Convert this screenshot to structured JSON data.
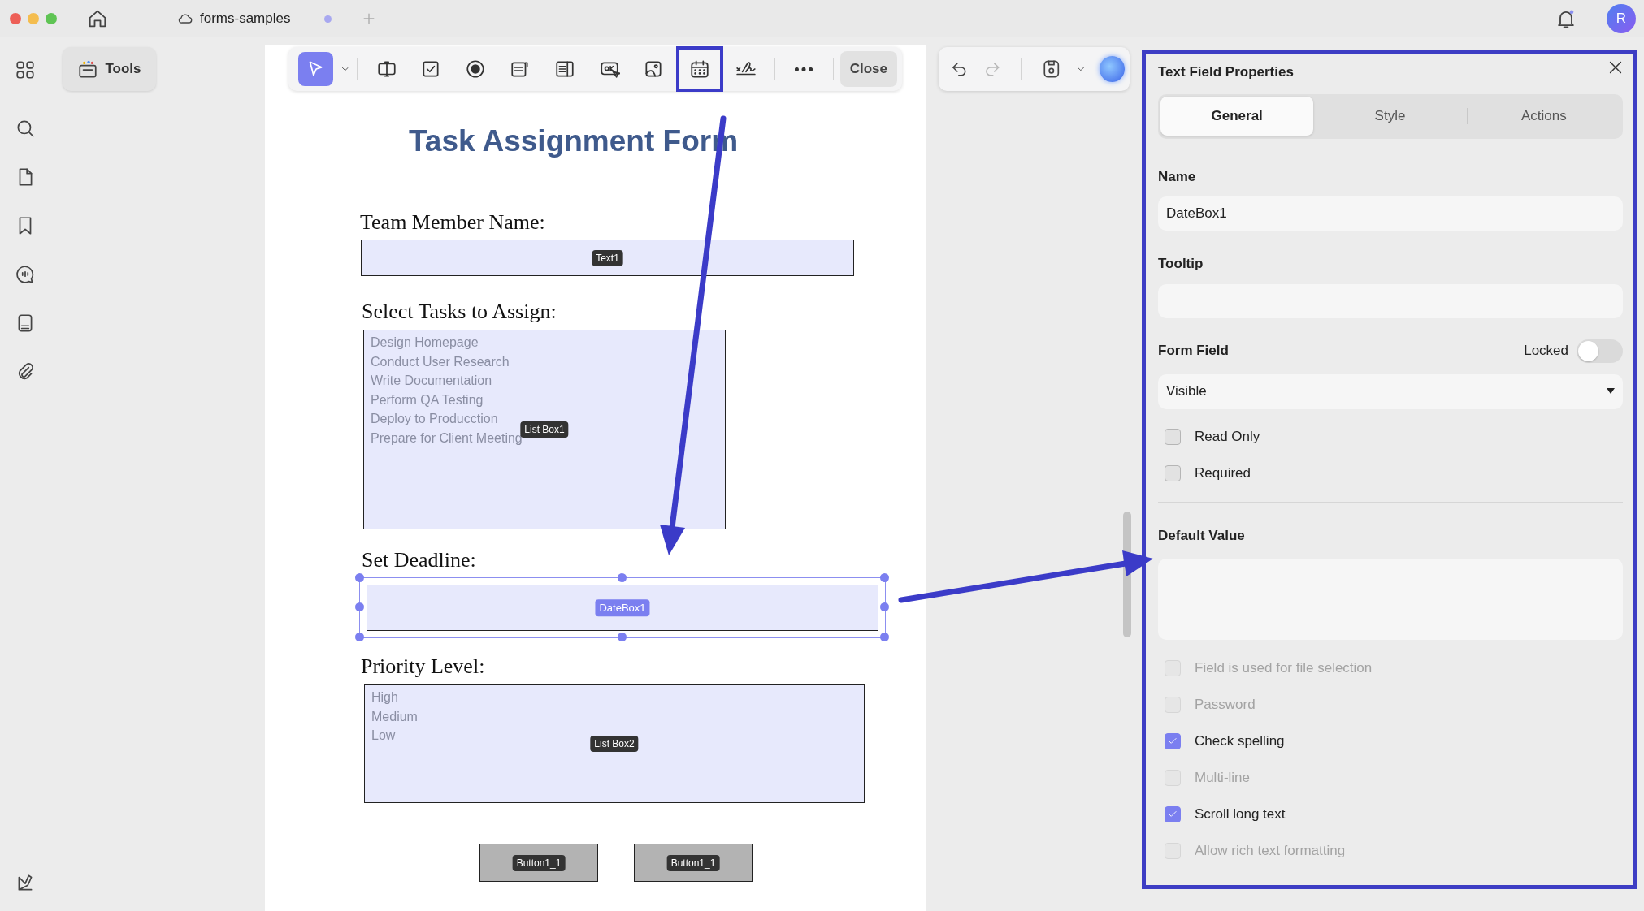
{
  "window": {
    "tab_title": "forms-samples",
    "avatar": "R"
  },
  "sidebar": {
    "tools_label": "Tools"
  },
  "toolbar": {
    "tools": [
      {
        "kind": "select",
        "selected": true,
        "highlighted": false
      },
      {
        "kind": "text-field",
        "selected": false,
        "highlighted": false
      },
      {
        "kind": "checkbox",
        "selected": false,
        "highlighted": false
      },
      {
        "kind": "radio",
        "selected": false,
        "highlighted": false
      },
      {
        "kind": "combo",
        "selected": false,
        "highlighted": false
      },
      {
        "kind": "list",
        "selected": false,
        "highlighted": false
      },
      {
        "kind": "button",
        "selected": false,
        "highlighted": false
      },
      {
        "kind": "image",
        "selected": false,
        "highlighted": false
      },
      {
        "kind": "date",
        "selected": false,
        "highlighted": true
      },
      {
        "kind": "signature",
        "selected": false,
        "highlighted": false
      },
      {
        "kind": "more",
        "selected": false,
        "highlighted": false
      }
    ],
    "close": "Close"
  },
  "document": {
    "title": "Task Assignment Form",
    "sections": [
      {
        "label": "Team Member Name:",
        "field": {
          "kind": "text",
          "tag": "Text1",
          "selected": false
        }
      },
      {
        "label": "Select Tasks to Assign:",
        "field": {
          "kind": "list",
          "tag": "List Box1",
          "selected": false,
          "options": [
            "Design Homepage",
            "Conduct User Research",
            "Write Documentation",
            "Perform QA Testing",
            "Deploy to Producction",
            "Prepare for Client Meeting"
          ]
        }
      },
      {
        "label": "Set Deadline:",
        "field": {
          "kind": "date",
          "tag": "DateBox1",
          "selected": true
        }
      },
      {
        "label": "Priority Level:",
        "field": {
          "kind": "list",
          "tag": "List Box2",
          "selected": false,
          "options": [
            "High",
            "Medium",
            "Low"
          ]
        }
      }
    ],
    "buttons": [
      {
        "tag": "Button1_1"
      },
      {
        "tag": "Button1_1"
      }
    ]
  },
  "panel": {
    "title": "Text Field Properties",
    "tabs": [
      {
        "label": "General",
        "selected": true
      },
      {
        "label": "Style",
        "selected": false
      },
      {
        "label": "Actions",
        "selected": false
      }
    ],
    "name_label": "Name",
    "name_value": "DateBox1",
    "tooltip_label": "Tooltip",
    "form_field_label": "Form Field",
    "locked_label": "Locked",
    "locked": false,
    "visibility": "Visible",
    "flags": [
      {
        "label": "Read Only",
        "checked": false,
        "disabled": false
      },
      {
        "label": "Required",
        "checked": false,
        "disabled": false
      }
    ],
    "default_value_label": "Default Value",
    "options": [
      {
        "label": "Field is used for file selection",
        "checked": false,
        "disabled": true
      },
      {
        "label": "Password",
        "checked": false,
        "disabled": true
      },
      {
        "label": "Check spelling",
        "checked": true,
        "disabled": false
      },
      {
        "label": "Multi-line",
        "checked": false,
        "disabled": true
      },
      {
        "label": "Scroll long text",
        "checked": true,
        "disabled": false
      },
      {
        "label": "Allow rich text formatting",
        "checked": false,
        "disabled": true
      }
    ]
  }
}
